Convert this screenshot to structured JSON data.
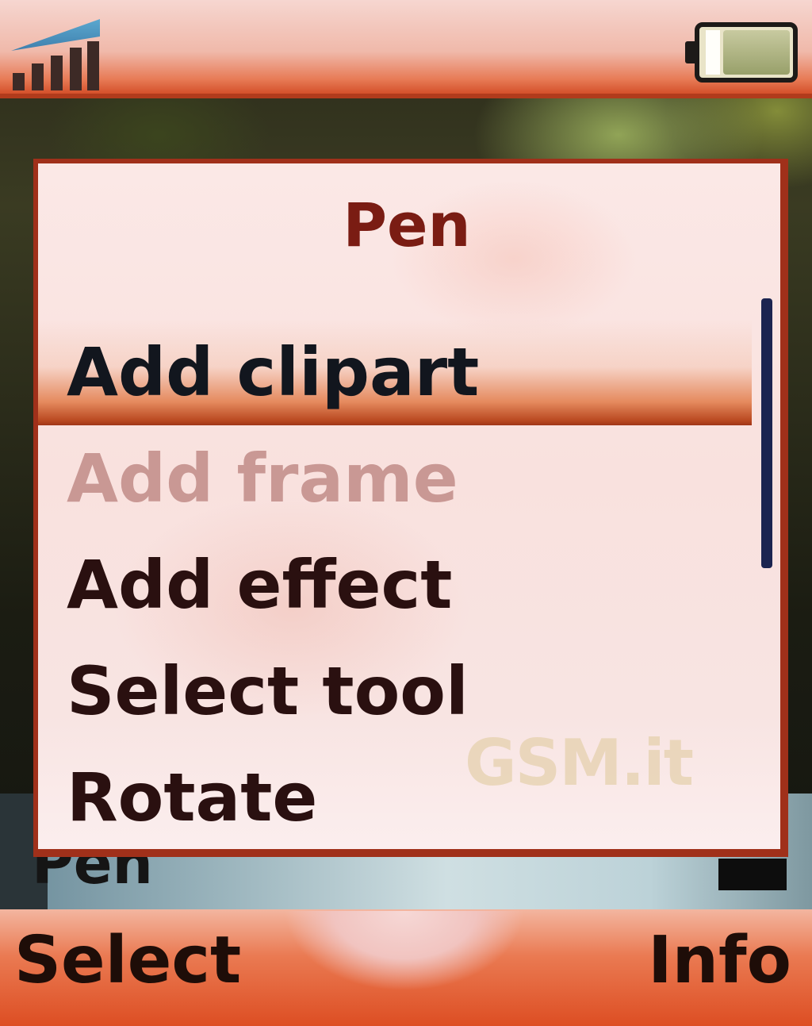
{
  "status_bar": {
    "signal_icon": "signal-strength-icon",
    "battery_icon": "battery-icon"
  },
  "background_label": "Pen",
  "dialog": {
    "title": "Pen",
    "items": [
      {
        "label": "Add clipart",
        "state": "selected"
      },
      {
        "label": "Add frame",
        "state": "disabled"
      },
      {
        "label": "Add effect",
        "state": "normal"
      },
      {
        "label": "Select tool",
        "state": "normal"
      },
      {
        "label": "Rotate",
        "state": "normal"
      }
    ],
    "watermark": "GSM.it"
  },
  "softkeys": {
    "left": "Select",
    "right": "Info"
  },
  "colors": {
    "accent": "#dd4e23",
    "title_text": "#7a1c13",
    "disabled_text": "#c99894",
    "scrollbar": "#1b2450"
  }
}
